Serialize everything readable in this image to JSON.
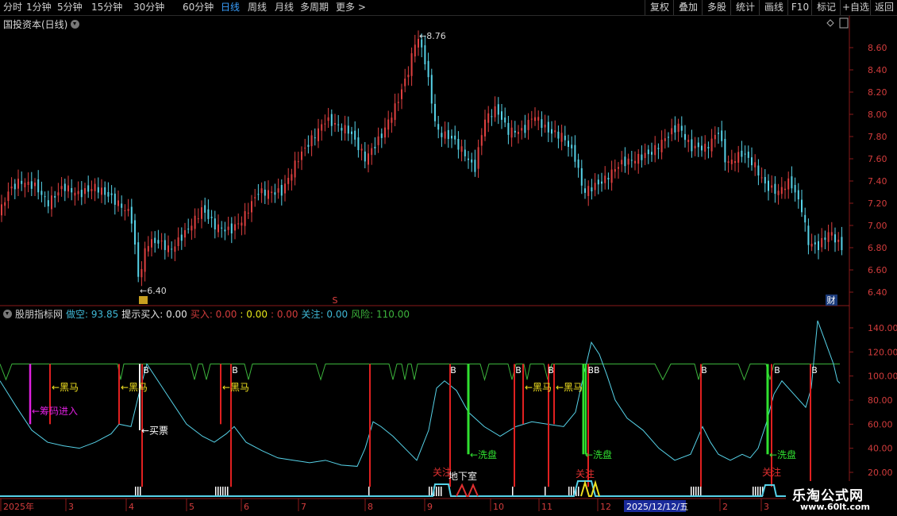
{
  "toolbar": {
    "periods": [
      "分时",
      "1分钟",
      "5分钟",
      "15分钟",
      "30分钟",
      "60分钟",
      "日线",
      "周线",
      "月线",
      "多周期",
      "更多 >"
    ],
    "active_period": "日线",
    "right_buttons": [
      "复权",
      "叠加",
      "多股",
      "统计",
      "画线",
      "F10",
      "标记",
      "+自选",
      "返回"
    ]
  },
  "main_panel": {
    "title": "国投资本(日线)",
    "high_label": "8.76",
    "low_label": "6.40",
    "marker_s": "S",
    "marker_cai": "财",
    "y_ticks": [
      "8.60",
      "8.40",
      "8.20",
      "8.00",
      "7.80",
      "7.60",
      "7.40",
      "7.20",
      "7.00",
      "6.80",
      "6.60",
      "6.40"
    ]
  },
  "indicator": {
    "name": "股朋指标网",
    "items": [
      {
        "label": "做空:",
        "value": "93.85",
        "color": "#3fb8d6"
      },
      {
        "label": "提示买入:",
        "value": "0.00",
        "color": "#e6e6e6"
      },
      {
        "label": "买入:",
        "value": "0.00",
        "color": "#d23c3c"
      },
      {
        "label": ":",
        "value": "0.00",
        "color": "#e6e619"
      },
      {
        "label": ":",
        "value": "0.00",
        "color": "#d23c3c"
      },
      {
        "label": "关注:",
        "value": "0.00",
        "color": "#3fb8d6"
      },
      {
        "label": "风险:",
        "value": "110.00",
        "color": "#3cb43c"
      }
    ],
    "y_ticks": [
      "140.00",
      "120.00",
      "100.00",
      "80.00",
      "60.00",
      "40.00",
      "20.00"
    ],
    "annotations": {
      "heima": "←黑马",
      "chouma": "←筹码进入",
      "maipiao": "←买票",
      "xipan": "←洗盘",
      "guanzhu": "关注",
      "dixiashi": "地下室",
      "b": "B",
      "bb": "BB"
    }
  },
  "date_axis": {
    "labels": [
      "2025年",
      "3",
      "4",
      "5",
      "6",
      "7",
      "8",
      "9",
      "10",
      "11",
      "12",
      "2",
      "3"
    ],
    "cursor_date": "2025/12/12/五"
  },
  "watermark": {
    "line1": "乐淘公式网",
    "line2": "www.60lt.com"
  }
}
